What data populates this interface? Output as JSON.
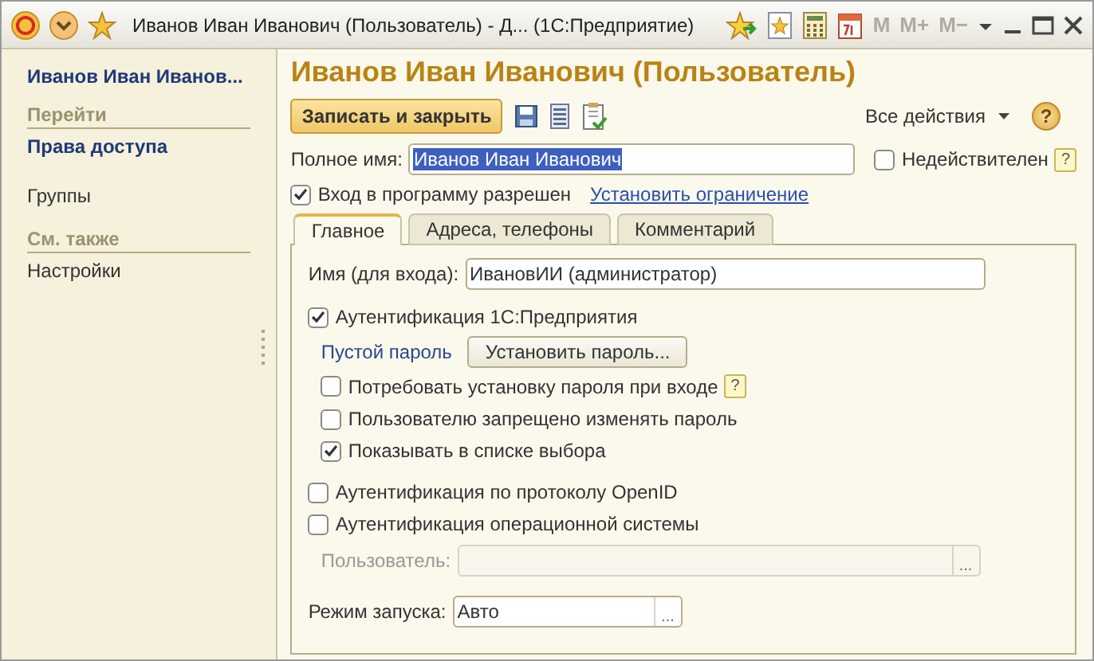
{
  "window": {
    "title": "Иванов Иван Иванович (Пользователь) - Д...  (1С:Предприятие)",
    "memory_buttons": [
      "M",
      "M+",
      "M−"
    ]
  },
  "sidebar": {
    "title": "Иванов Иван Иванов...",
    "sections": [
      {
        "heading": "Перейти",
        "items": [
          {
            "label": "Права доступа",
            "selected": true
          },
          {
            "label": "Группы",
            "selected": false
          }
        ]
      },
      {
        "heading": "См. также",
        "items": [
          {
            "label": "Настройки",
            "selected": false
          }
        ]
      }
    ]
  },
  "form": {
    "title": "Иванов Иван Иванович (Пользователь)",
    "save_button": "Записать и закрыть",
    "all_actions": "Все действия",
    "help": "?",
    "full_name": {
      "label": "Полное имя:",
      "value": "Иванов Иван Иванович",
      "highlighted": true
    },
    "inactive": {
      "label": "Недействителен",
      "checked": false,
      "hint": "?"
    },
    "login_allowed": {
      "label": "Вход в программу разрешен",
      "checked": true
    },
    "restriction_link": "Установить ограничение",
    "tabs": [
      {
        "label": "Главное",
        "selected": true
      },
      {
        "label": "Адреса, телефоны",
        "selected": false
      },
      {
        "label": "Комментарий",
        "selected": false
      }
    ],
    "login_name": {
      "label": "Имя (для входа):",
      "value": "ИвановИИ (администратор)"
    },
    "auth_1c": {
      "label": "Аутентификация 1С:Предприятия",
      "checked": true
    },
    "password": {
      "status": "Пустой пароль",
      "button": "Установить пароль..."
    },
    "password_options": [
      {
        "label": "Потребовать установку пароля при входе",
        "checked": false,
        "hint": "?"
      },
      {
        "label": "Пользователю запрещено изменять пароль",
        "checked": false
      },
      {
        "label": "Показывать в списке выбора",
        "checked": true
      }
    ],
    "openid": {
      "label": "Аутентификация по протоколу OpenID",
      "checked": false
    },
    "os_auth": {
      "label": "Аутентификация операционной системы",
      "checked": false
    },
    "os_user": {
      "label": "Пользователь:",
      "disabled": true,
      "select_button": "..."
    },
    "launch_mode": {
      "label": "Режим запуска:",
      "value": "Авто",
      "select_button": "..."
    }
  }
}
